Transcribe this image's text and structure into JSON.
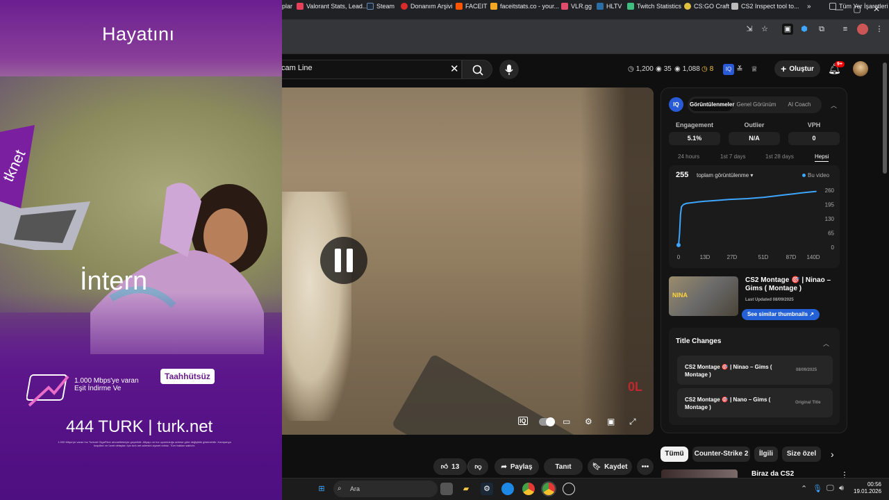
{
  "browser": {
    "window_controls": [
      "—",
      "▢",
      "✕"
    ],
    "bookmarks": [
      {
        "label": "plar",
        "color": "#888888"
      },
      {
        "label": "Valorant Stats, Lead...",
        "color": "#e83f5b"
      },
      {
        "label": "Steam",
        "color": "#1b2838"
      },
      {
        "label": "Donanım Arşivi",
        "color": "#d92b2b"
      },
      {
        "label": "FACEIT",
        "color": "#ff5500"
      },
      {
        "label": "faceitstats.co - your...",
        "color": "#f5a623"
      },
      {
        "label": "VLR.gg",
        "color": "#e04c6c"
      },
      {
        "label": "HLTV",
        "color": "#2b6ea6"
      },
      {
        "label": "Twitch Statistics",
        "color": "#3fbf7f"
      },
      {
        "label": "CS:GO Craft",
        "color": "#e0c040"
      },
      {
        "label": "CS2 Inspect tool to...",
        "color": "#bbbbbb"
      },
      {
        "label": "»",
        "color": ""
      },
      {
        "label": "Tüm Yer İşaretleri",
        "color": "#bbbbbb"
      }
    ]
  },
  "youtube": {
    "search_value": "cam Line",
    "stats": [
      {
        "icon": "clock-icon",
        "value": "1,200"
      },
      {
        "icon": "eye-icon",
        "value": "35"
      },
      {
        "icon": "eye-icon",
        "value": "1,088"
      },
      {
        "icon": "coin-icon",
        "value": "8"
      }
    ],
    "create_label": "Oluştur",
    "notif_badge": "9+"
  },
  "ad": {
    "headline": "Hayatını",
    "laptop_brand": "tknet",
    "big_word": "İntern",
    "speed_text_line1": "1.000 Mbps'ye varan",
    "speed_text_line2": "Eşit İndirme Ve",
    "pill": "Taahhütsüz",
    "phone_line": "444 TURK  |  turk.net",
    "fine_print": "1.000 Mbps'ye varan hız Turknet GigaFiber abonelikleriyle geçerlidir. Altyapı ve hız uyumluluğu adrese göre değişiklik gösterebilir. Kampanya koşulları ve ücret detayları için turk.net adresini ziyaret ediniz. Tüm hakları saklıdır."
  },
  "video": {
    "score_overlay": "0L",
    "controls": [
      "iq-icon",
      "autoplay-toggle",
      "subtitles-icon",
      "settings-icon",
      "theater-icon",
      "fullscreen-icon"
    ]
  },
  "panel": {
    "iq_badge": "IQ",
    "tabs": [
      "Görüntülenmeler",
      "Genel Görünüm",
      "AI Coach"
    ],
    "active_tab": "Görüntülenmeler",
    "metrics": [
      {
        "label": "Engagement",
        "value": "5.1%"
      },
      {
        "label": "Outlier",
        "value": "N/A"
      },
      {
        "label": "VPH",
        "value": "0"
      }
    ],
    "ranges": [
      "24 hours",
      "1st 7 days",
      "1st 28 days",
      "Hepsi"
    ],
    "active_range": "Hepsi",
    "chart_total": "255",
    "chart_label": "toplam görüntülenme ▾",
    "chart_legend": "Bu video",
    "video_title": "CS2 Montage 🎯 | Ninao – Gims ( Montage )",
    "thumb_text": "NINA",
    "last_updated": "Last Updated 08/09/2025",
    "similar_button": "See similar thumbnails ↗",
    "title_changes_heading": "Title Changes",
    "title_changes": [
      {
        "title": "CS2 Montage 🎯 | Ninao – Gims ( Montage )",
        "tag": "08/09/2025"
      },
      {
        "title": "CS2 Montage 🎯 | Nano – Gims ( Montage )",
        "tag": "Original Title"
      }
    ]
  },
  "chart_data": {
    "type": "line",
    "title": "",
    "xlabel": "",
    "ylabel": "",
    "x_ticks": [
      "0",
      "13D",
      "27D",
      "51D",
      "87D",
      "140D"
    ],
    "y_ticks": [
      "260",
      "195",
      "130",
      "65",
      "0"
    ],
    "ylim": [
      0,
      260
    ],
    "xlim": [
      0,
      140
    ],
    "grid": false,
    "series": [
      {
        "name": "Bu video",
        "color": "#3ea6ff",
        "x": [
          0,
          1,
          2,
          3,
          5,
          8,
          13,
          20,
          27,
          40,
          51,
          70,
          87,
          110,
          125,
          140
        ],
        "y": [
          10,
          60,
          150,
          185,
          195,
          200,
          203,
          207,
          210,
          214,
          218,
          222,
          228,
          240,
          248,
          255
        ]
      }
    ]
  },
  "actions": {
    "like_count": "13",
    "share": "Paylaş",
    "thanks": "Tanıt",
    "save": "Kaydet"
  },
  "chips": [
    "Tümü",
    "Counter-Strike 2",
    "İlgili",
    "Size özel"
  ],
  "recommended": {
    "title": "Biraz da CS2"
  },
  "taskbar": {
    "search_placeholder": "Ara",
    "time": "00:56",
    "date": "19.01.2026"
  }
}
